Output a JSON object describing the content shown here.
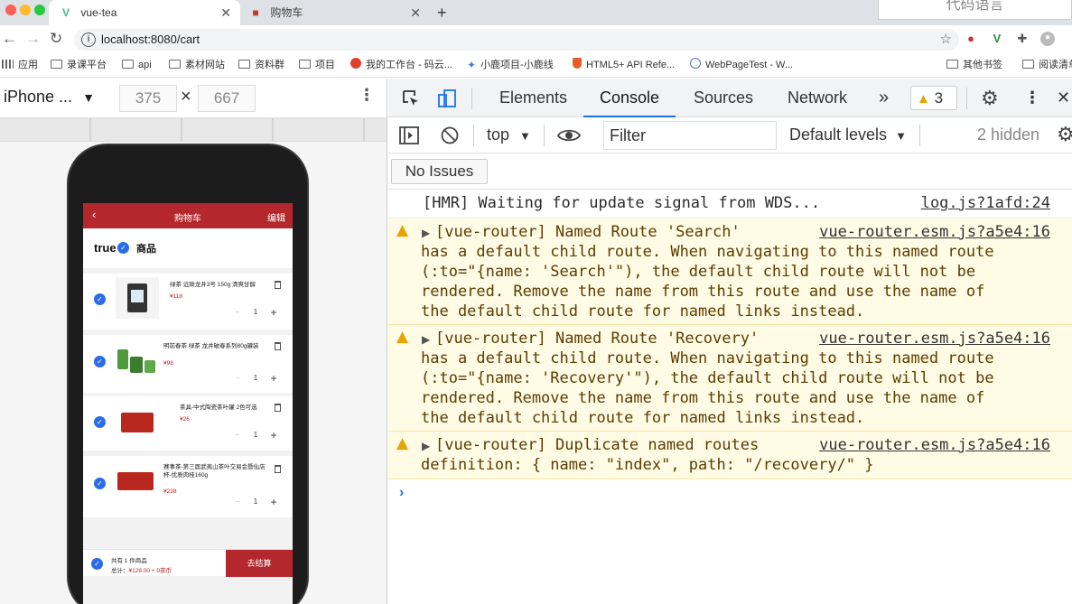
{
  "browser": {
    "tabs": [
      {
        "label": "vue-tea",
        "favicon": "vue-logo-icon",
        "active": true
      },
      {
        "label": "购物车",
        "favicon": "cart-favicon-icon",
        "active": false
      }
    ],
    "overlay_text": "代码语言",
    "url": "localhost:8080/cart",
    "bookmarks": [
      {
        "label": "应用",
        "icon": "apps-grid-icon"
      },
      {
        "label": "录课平台",
        "icon": "folder-icon"
      },
      {
        "label": "api",
        "icon": "folder-icon"
      },
      {
        "label": "素材网站",
        "icon": "folder-icon"
      },
      {
        "label": "资料群",
        "icon": "folder-icon"
      },
      {
        "label": "项目",
        "icon": "folder-icon"
      },
      {
        "label": "我的工作台 - 码云...",
        "icon": "gitee-icon"
      },
      {
        "label": "小鹿项目-小鹿线",
        "icon": "deer-icon"
      },
      {
        "label": "HTML5+ API Refe...",
        "icon": "shield-icon"
      },
      {
        "label": "WebPageTest - W...",
        "icon": "globe-icon"
      },
      {
        "label": "其他书签",
        "icon": "folder-icon"
      },
      {
        "label": "阅读清单",
        "icon": "reading-list-icon"
      }
    ]
  },
  "device": {
    "name": "iPhone ...",
    "width": "375",
    "height": "667"
  },
  "app": {
    "header_title": "购物车",
    "header_edit": "编辑",
    "select_all_label": "true",
    "goods_label": "商品",
    "items": [
      {
        "name": "绿茶 远致龙井3号 150g 清爽甘醇",
        "price": "¥118",
        "qty": "1"
      },
      {
        "name": "明前春茶 绿茶 龙井破春系列80g罐装",
        "price": "¥98",
        "qty": "1"
      },
      {
        "name": "茶具-中式陶瓷茶叶罐 2色可选",
        "price": "¥26",
        "qty": "1"
      },
      {
        "name": "赛事茶-第三届武夷山茶叶交易会暨仙店杯-优质肉桂160g",
        "price": "¥238",
        "qty": "1"
      }
    ],
    "footer_count": "共有 1 件商品",
    "footer_total_label": "总计：",
    "footer_total_value": "¥128.00 + 0茶币",
    "checkout": "去结算"
  },
  "devtools": {
    "tabs": [
      "Elements",
      "Console",
      "Sources",
      "Network"
    ],
    "selected_tab": "Console",
    "more_tabs": "»",
    "warning_count": "3",
    "context": "top",
    "filter_placeholder": "Filter",
    "levels": "Default levels",
    "hidden": "2 hidden",
    "issues": "No Issues",
    "logs": [
      {
        "level": "info",
        "lines": [
          "[HMR] Waiting for update signal from WDS..."
        ],
        "source": "log.js?1afd:24"
      },
      {
        "level": "warning",
        "lines": [
          "[vue-router] Named Route 'Search'",
          "has a default child route. When navigating to this named route",
          "(:to=\"{name: 'Search'\"), the default child route will not be",
          "rendered. Remove the name from this route and use the name of",
          "the default child route for named links instead."
        ],
        "source": "vue-router.esm.js?a5e4:16"
      },
      {
        "level": "warning",
        "lines": [
          "[vue-router] Named Route 'Recovery'",
          "has a default child route. When navigating to this named route",
          "(:to=\"{name: 'Recovery'\"), the default child route will not be",
          "rendered. Remove the name from this route and use the name of",
          "the default child route for named links instead."
        ],
        "source": "vue-router.esm.js?a5e4:16"
      },
      {
        "level": "warning",
        "lines": [
          "[vue-router] Duplicate named routes",
          "definition: { name: \"index\", path: \"/recovery/\" }"
        ],
        "source": "vue-router.esm.js?a5e4:16"
      }
    ],
    "prompt": "›"
  },
  "colors": {
    "brand_red": "#b4282d",
    "check_blue": "#2b6ce8",
    "devtools_accent": "#1a73e8",
    "warning_bg": "#fffbe5",
    "warning_icon": "#e6a400"
  }
}
